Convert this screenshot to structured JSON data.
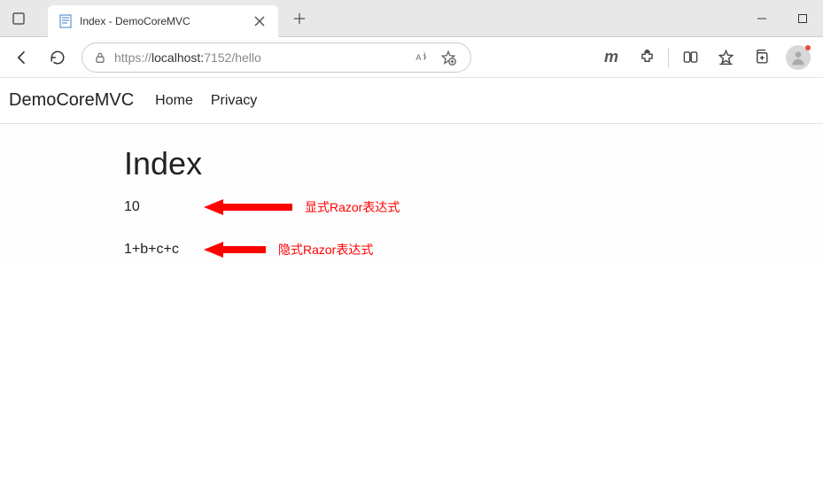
{
  "browser": {
    "tab_title": "Index - DemoCoreMVC",
    "url_prefix": "https://",
    "url_host": "localhost:",
    "url_port_path": "7152/hello"
  },
  "site_nav": {
    "brand": "DemoCoreMVC",
    "links": [
      "Home",
      "Privacy"
    ]
  },
  "page": {
    "heading": "Index",
    "line1_value": "10",
    "line1_annotation": "显式Razor表达式",
    "line2_value": "1+b+c+c",
    "line2_annotation": "隐式Razor表达式"
  }
}
